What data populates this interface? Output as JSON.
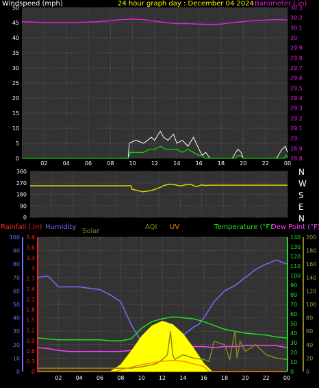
{
  "header": {
    "windspeed_label": "Windspeed (mph)",
    "title": "24 hour graph day : December 04 2024",
    "barometer_label": "Barometer (.in)"
  },
  "lower_header": {
    "rainfall": "Rainfall (.in)",
    "humidity": "Humidity",
    "solar": "Solar",
    "aqi": "AQI",
    "uv": "UV",
    "temperature": "Temperature (°F)",
    "dewpoint": "Dew Point (°F)"
  },
  "colors": {
    "windspeed": "#ffffff",
    "barometer": "#e020e0",
    "title": "#ffff00",
    "winddir": "#d8d800",
    "rainfall": "#ff2020",
    "humidity": "#7070ff",
    "solar": "#ffff00",
    "aqi": "#888820",
    "uv": "#ff8800",
    "temperature": "#20e020",
    "dewpoint": "#ff40ff",
    "grid": "#606060",
    "panel": "#333333"
  },
  "x_tick_labels": [
    "02",
    "04",
    "06",
    "08",
    "10",
    "12",
    "14",
    "16",
    "18",
    "20",
    "22",
    "00"
  ],
  "chart_data": [
    {
      "type": "line",
      "name": "wind_barometer",
      "x_unit": "hour",
      "x_range": [
        0,
        24
      ],
      "y_left": {
        "label": "Windspeed (mph)",
        "ylim": [
          0,
          50
        ],
        "ticks": [
          0,
          5,
          10,
          15,
          20,
          25,
          30,
          35,
          40,
          45,
          50
        ]
      },
      "y_right": {
        "label": "Barometer (.in)",
        "ylim": [
          28.8,
          30.3
        ],
        "ticks": [
          "28.8",
          "28.9",
          "29",
          "29.1",
          "29.2",
          "29.3",
          "29.4",
          "29.5",
          "29.6",
          "29.7",
          "29.8",
          "29.9",
          "30",
          "30.1",
          "30.2",
          "30.3"
        ]
      },
      "series": [
        {
          "name": "Barometer",
          "axis": "right",
          "color": "#e020e0",
          "x": [
            0,
            1,
            2,
            3,
            4,
            5,
            6,
            7,
            8,
            9,
            10,
            11,
            12,
            13,
            14,
            15,
            16,
            17,
            18,
            19,
            20,
            21,
            22,
            23,
            24
          ],
          "y": [
            30.16,
            30.155,
            30.15,
            30.15,
            30.15,
            30.152,
            30.155,
            30.16,
            30.17,
            30.18,
            30.185,
            30.18,
            30.165,
            30.15,
            30.14,
            30.14,
            30.135,
            30.13,
            30.135,
            30.15,
            30.16,
            30.17,
            30.175,
            30.18,
            30.175
          ]
        },
        {
          "name": "Wind gust",
          "axis": "left",
          "color": "#ffffff",
          "x": [
            0,
            9.6,
            9.7,
            10.3,
            11,
            11.7,
            12,
            12.5,
            12.8,
            13.2,
            13.7,
            14,
            14.5,
            15,
            15.5,
            16,
            16.3,
            16.6,
            17,
            18,
            19,
            19.5,
            19.8,
            20,
            21,
            22,
            23,
            23.5,
            23.8,
            24
          ],
          "y": [
            0,
            0,
            5,
            6,
            5,
            7,
            6,
            9,
            7,
            6,
            8,
            5,
            6,
            4,
            7,
            3,
            1,
            2,
            0,
            0,
            0,
            3,
            2,
            0,
            0,
            0,
            0,
            3,
            4,
            2
          ]
        },
        {
          "name": "Wind avg",
          "axis": "left",
          "color": "#00ff00",
          "x": [
            0,
            9.6,
            9.8,
            10.3,
            11,
            11.5,
            12,
            12.5,
            13,
            13.5,
            14,
            14.5,
            15,
            15.5,
            16,
            16.3,
            16.5,
            17,
            19.3,
            19.5,
            19.8,
            20,
            23.7,
            23.9,
            24
          ],
          "y": [
            0,
            0,
            2,
            2,
            2,
            3,
            3,
            4,
            3,
            3,
            3,
            2,
            3,
            2,
            1,
            1,
            0,
            0,
            0,
            1,
            1,
            0,
            0,
            1,
            0
          ]
        }
      ]
    },
    {
      "type": "line",
      "name": "wind_direction",
      "y_range": [
        0,
        360
      ],
      "y_ticks": [
        0,
        90,
        180,
        270,
        360
      ],
      "compass_labels": [
        "N",
        "W",
        "S",
        "E",
        "N"
      ],
      "series": [
        {
          "name": "Wind direction",
          "color": "#d8d800",
          "x": [
            0,
            9.4,
            9.5,
            10,
            10.5,
            11,
            11.5,
            12,
            12.5,
            13,
            13.5,
            14,
            14.5,
            15,
            15.5,
            16,
            16.2,
            17,
            24
          ],
          "y": [
            247,
            247,
            220,
            210,
            200,
            205,
            215,
            230,
            250,
            260,
            255,
            245,
            255,
            258,
            240,
            255,
            250,
            252,
            252
          ]
        }
      ]
    },
    {
      "type": "line",
      "name": "conditions",
      "axes": {
        "rainfall": {
          "ylim": [
            0,
            3.9
          ],
          "ticks": [
            "0",
            "0.3",
            "0.6",
            "0.9",
            "1.2",
            "1.5",
            "1.8",
            "2.1",
            "2.4",
            "2.7",
            "3",
            "3.3",
            "3.6",
            "3.9"
          ]
        },
        "humidity": {
          "ylim": [
            0,
            100
          ],
          "ticks": [
            0,
            10,
            20,
            30,
            40,
            50,
            60,
            70,
            80,
            90,
            100
          ]
        },
        "temperature": {
          "ylim": [
            0,
            140
          ],
          "ticks": [
            0,
            10,
            20,
            30,
            40,
            50,
            60,
            70,
            80,
            90,
            100,
            110,
            120,
            130,
            140
          ]
        },
        "solar": {
          "ylim": [
            0,
            200
          ],
          "ticks": [
            0,
            20,
            40,
            60,
            80,
            100,
            120,
            140,
            160,
            180,
            200
          ]
        }
      },
      "series": [
        {
          "name": "Humidity",
          "axis": "humidity",
          "color": "#7070ff",
          "x": [
            0,
            1,
            2,
            3,
            4,
            5,
            6,
            6.5,
            7,
            8,
            9,
            10,
            11,
            12,
            13,
            14,
            15,
            15.5,
            16,
            17,
            18,
            19,
            20,
            21,
            22,
            23,
            24
          ],
          "y": [
            70,
            71,
            63,
            63,
            63,
            62,
            61,
            59,
            57,
            52,
            35,
            22,
            21,
            24,
            25,
            27,
            33,
            35,
            40,
            52,
            60,
            64,
            70,
            76,
            80,
            83,
            80
          ]
        },
        {
          "name": "Temperature",
          "axis": "temperature",
          "color": "#20e020",
          "x": [
            0,
            1,
            2,
            3,
            4,
            5,
            6,
            7,
            8,
            9,
            10,
            11,
            12,
            13,
            14,
            15,
            16,
            17,
            18,
            19,
            20,
            21,
            22,
            23,
            24
          ],
          "y": [
            35,
            34,
            33,
            33,
            33,
            33,
            33,
            32,
            32,
            34,
            45,
            52,
            55,
            57,
            56,
            55,
            52,
            48,
            44,
            42,
            40,
            39,
            38,
            36,
            35
          ]
        },
        {
          "name": "Dew Point",
          "axis": "temperature",
          "color": "#ff40ff",
          "x": [
            0,
            1,
            2,
            3,
            4,
            5,
            6,
            7,
            8,
            9,
            10,
            11,
            12,
            13,
            14,
            15,
            16,
            17,
            18,
            19,
            20,
            21,
            22,
            23,
            24
          ],
          "y": [
            25,
            24,
            22,
            21,
            21,
            21,
            21,
            21,
            21,
            22,
            22,
            21,
            22,
            24,
            25,
            26,
            26,
            25,
            26,
            26,
            27,
            27,
            27,
            27,
            25
          ]
        },
        {
          "name": "Solar",
          "axis": "solar",
          "color": "#ffff00",
          "fill": true,
          "x": [
            7,
            8,
            9,
            10,
            11,
            12,
            13,
            14,
            15,
            16,
            16.8
          ],
          "y": [
            0,
            10,
            30,
            52,
            68,
            75,
            70,
            56,
            35,
            12,
            0
          ]
        },
        {
          "name": "AQI",
          "axis": "solar",
          "color": "#888820",
          "x": [
            0,
            7,
            8,
            9,
            10,
            11,
            11.5,
            12,
            12.5,
            12.8,
            13,
            13.2,
            14,
            15,
            16,
            16.5,
            17,
            18,
            18.5,
            19,
            19.2,
            19.5,
            20,
            21,
            22,
            23,
            24
          ],
          "y": [
            5,
            5,
            5,
            5,
            7,
            10,
            12,
            18,
            25,
            60,
            25,
            18,
            25,
            20,
            18,
            15,
            45,
            40,
            18,
            60,
            20,
            45,
            30,
            40,
            25,
            20,
            18
          ]
        },
        {
          "name": "UV",
          "axis": "rainfall",
          "color": "#ff8800",
          "x": [
            0,
            7.5,
            8,
            10,
            12,
            13,
            14,
            16,
            16.5,
            24
          ],
          "y": [
            0,
            0,
            0.05,
            0.2,
            0.3,
            0.32,
            0.3,
            0.15,
            0,
            0
          ]
        }
      ]
    }
  ]
}
